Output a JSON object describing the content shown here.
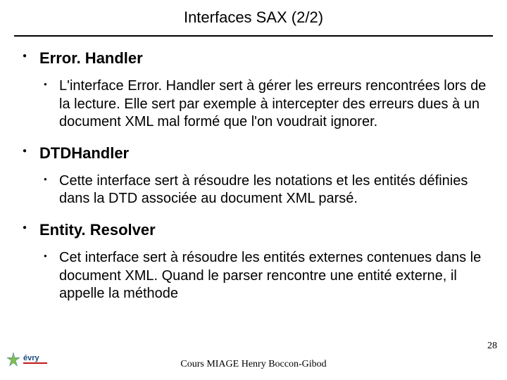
{
  "slide": {
    "title": "Interfaces SAX (2/2)",
    "sections": {
      "s1": {
        "heading": "Error. Handler",
        "body": "L'interface Error. Handler sert à gérer les erreurs rencontrées lors de la lecture. Elle sert par exemple à intercepter des erreurs dues à un document XML mal formé que l'on voudrait ignorer."
      },
      "s2": {
        "heading": "DTDHandler",
        "body": "Cette interface sert à résoudre les notations et les entités définies dans la DTD associée au document XML parsé."
      },
      "s3": {
        "heading": "Entity. Resolver",
        "body": "Cet interface sert à résoudre les entités externes contenues dans le document XML. Quand le parser rencontre une entité externe, il appelle la méthode"
      }
    },
    "footer": "Cours MIAGE      Henry Boccon-Gibod",
    "page_number": "28",
    "logo_label": "évry"
  }
}
